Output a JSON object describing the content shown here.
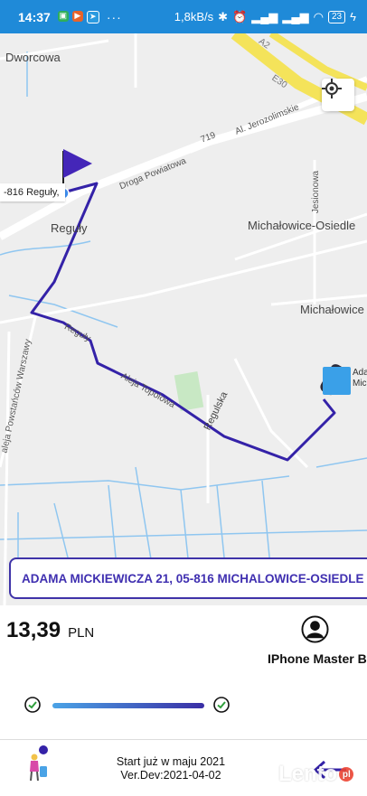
{
  "status_bar": {
    "time": "14:37",
    "speed": "1,8kB/s",
    "battery": "23",
    "more": "···"
  },
  "map": {
    "labels": {
      "dworcowa": "Dworcowa",
      "aleje_jerozolimskie": "Al. Jerozolimskie",
      "road_719": "719",
      "droga_powiatowa": "Droga Powiatowa",
      "jesionowa": "Jesionowa",
      "reguly": "Reguły",
      "michalowice_osiedle": "Michałowice-Osiedle",
      "michalowice": "Michałowice",
      "reguly_street": "Reguły",
      "aleja_topolowa": "Aleja Topolowa",
      "regulska": "Regulska",
      "aleja_powstancow": "aleja Powstańców Warszawy",
      "e30": "E30",
      "a2": "A2"
    },
    "pickup_tip": "-816 Reguły,",
    "dest_label_line1": "Ada",
    "dest_label_line2": "Mic"
  },
  "address": "ADAMA MICKIEWICZA 21, 05-816 MICHALOWICE-OSIEDLE",
  "fare": {
    "amount": "13,39",
    "currency": "PLN"
  },
  "driver": {
    "name": "IPhone Master B"
  },
  "footer": {
    "line1": "Start już w maju 2021",
    "line2": "Ver.Dev:2021-04-02",
    "watermark": "Lento",
    "watermark_suffix": "pl"
  },
  "colors": {
    "status_bar": "#1f8ad8",
    "route": "#3422a8",
    "accent": "#3f2fb0",
    "check_green": "#2e9e3a"
  },
  "icons": {
    "locate": "crosshair-icon",
    "avatar": "user-avatar-icon",
    "check": "check-circle-icon",
    "back": "arrow-left-icon"
  }
}
